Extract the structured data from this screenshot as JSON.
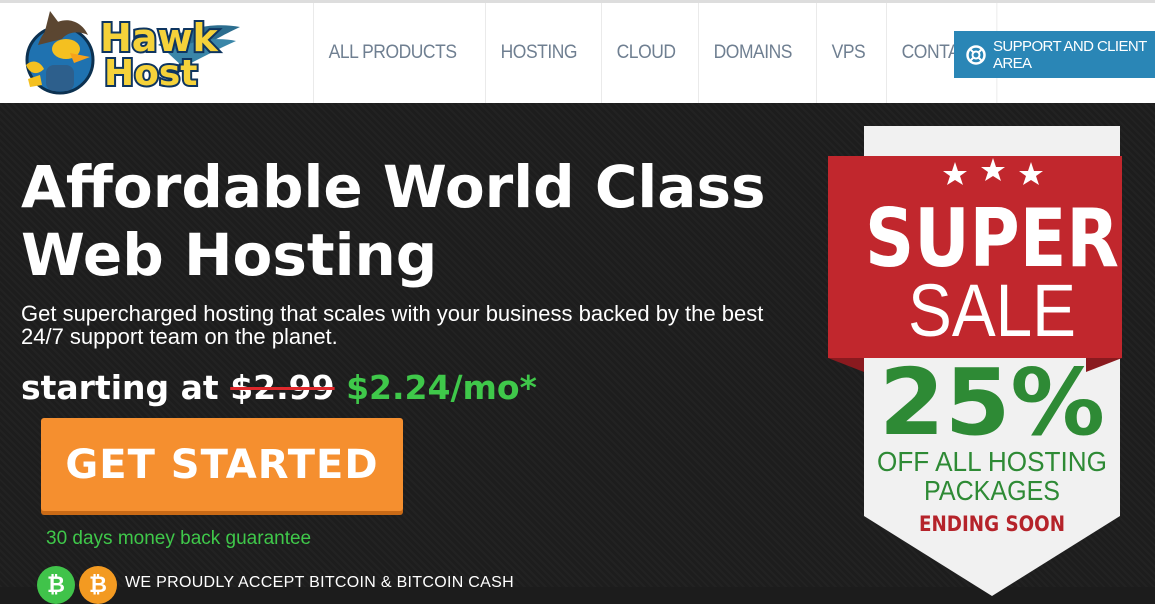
{
  "brand": {
    "logo_line1": "Hawk",
    "logo_line2": "Host",
    "colors": {
      "primary": "#2a86b6",
      "accent": "#f58f2f",
      "green": "#3fc84a",
      "red": "#c0272d"
    }
  },
  "nav": {
    "items": [
      "ALL PRODUCTS",
      "HOSTING",
      "CLOUD",
      "DOMAINS",
      "VPS",
      "CONTACT"
    ],
    "support_label": "SUPPORT AND CLIENT AREA",
    "support_icon": "lifebuoy-icon"
  },
  "hero": {
    "title_line1": "Affordable World Class",
    "title_line2": "Web Hosting",
    "subtitle": "Get supercharged hosting that scales with your business backed by the best 24/7 support team on the planet.",
    "price_prefix": "starting at",
    "old_price": "$2.99",
    "new_price": "$2.24/mo*",
    "cta_label": "GET STARTED",
    "guarantee": "30 days money back guarantee",
    "accept_text": "WE PROUDLY ACCEPT BITCOIN & BITCOIN CASH",
    "coin_symbol": "₿"
  },
  "sale": {
    "line1": "SUPER",
    "line2": "SALE",
    "percent": "25%",
    "off_line1": "OFF ALL HOSTING",
    "off_line2": "PACKAGES",
    "ending": "ENDING SOON"
  }
}
